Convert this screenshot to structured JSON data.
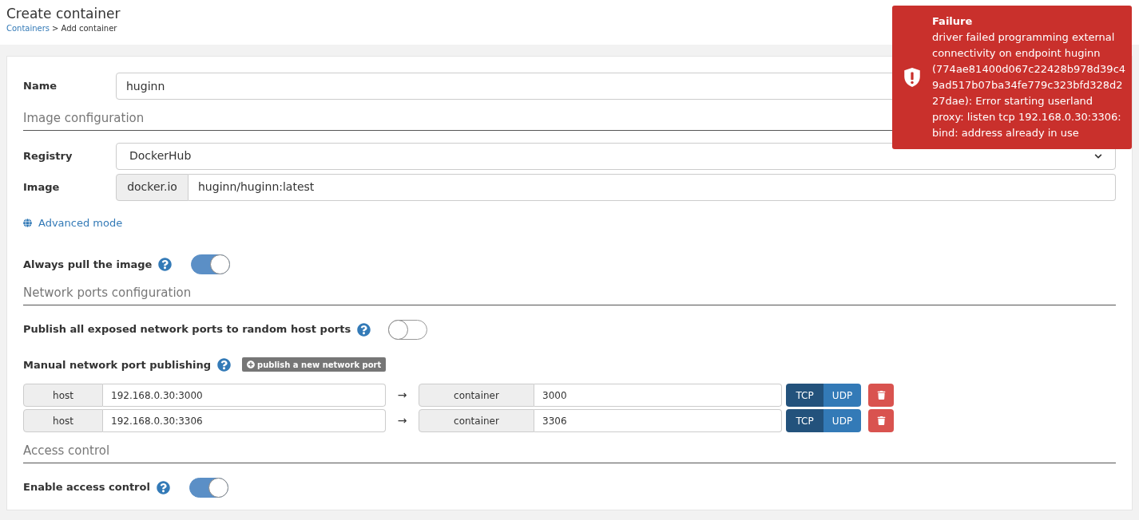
{
  "header": {
    "title": "Create container",
    "breadcrumb": {
      "link": "Containers",
      "separator": ">",
      "current": "Add container"
    }
  },
  "notification": {
    "title": "Failure",
    "message": "driver failed programming external connectivity on endpoint huginn (774ae81400d067c22428b978d39c49ad517b07ba34fe779c323bfd328d227dae): Error starting userland proxy: listen tcp 192.168.0.30:3306: bind: address already in use"
  },
  "name": {
    "label": "Name",
    "value": "huginn"
  },
  "image_section": {
    "title": "Image configuration",
    "registry_label": "Registry",
    "registry": "DockerHub",
    "image_label": "Image",
    "image_prefix": "docker.io",
    "image": "huginn/huginn:latest",
    "advanced": "Advanced mode"
  },
  "always_pull": {
    "label": "Always pull the image",
    "on": true
  },
  "ports_section": {
    "title": "Network ports configuration",
    "publish_all": {
      "label": "Publish all exposed network ports to random host ports",
      "on": false
    },
    "manual_label": "Manual network port publishing",
    "add_button": "publish a new network port",
    "ports": [
      {
        "host_label": "host",
        "host": "192.168.0.30:3000",
        "arrow": "→",
        "container_label": "container",
        "container": "3000",
        "protocols": [
          {
            "label": "TCP",
            "selected": true
          },
          {
            "label": "UDP",
            "selected": false
          }
        ]
      },
      {
        "host_label": "host",
        "host": "192.168.0.30:3306",
        "arrow": "→",
        "container_label": "container",
        "container": "3306",
        "protocols": [
          {
            "label": "TCP",
            "selected": true
          },
          {
            "label": "UDP",
            "selected": false
          }
        ]
      }
    ]
  },
  "access_section": {
    "title": "Access control",
    "enable": {
      "label": "Enable access control",
      "on": true
    }
  }
}
